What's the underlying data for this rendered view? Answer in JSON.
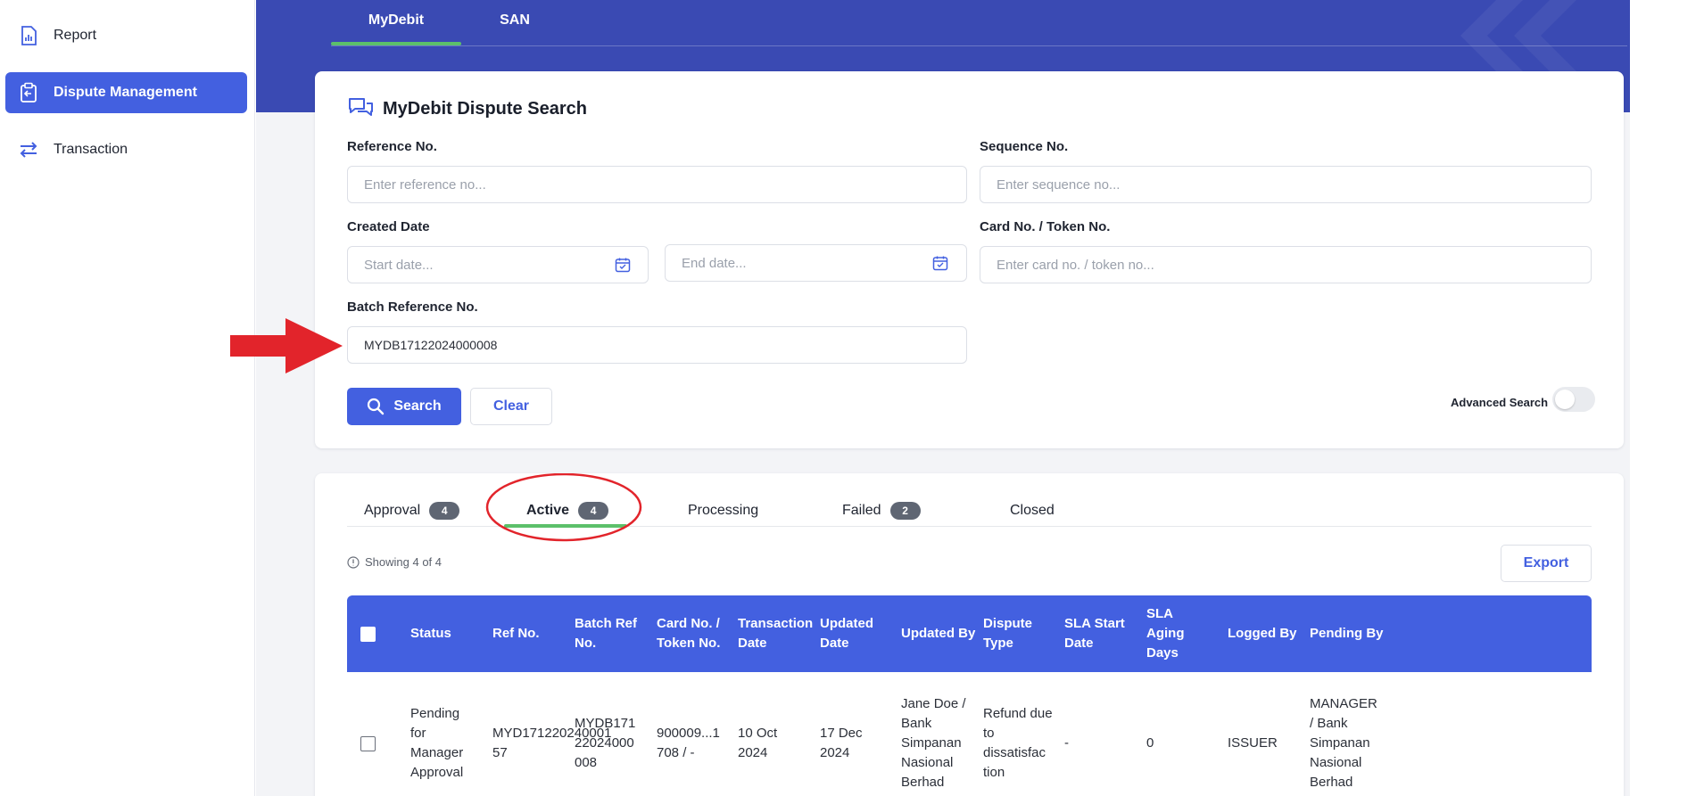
{
  "sidebar": {
    "items": [
      {
        "label": "Report",
        "icon": "report-icon",
        "active": false
      },
      {
        "label": "Dispute Management",
        "icon": "clipboard-icon",
        "active": true
      },
      {
        "label": "Transaction",
        "icon": "swap-arrows-icon",
        "active": false
      }
    ]
  },
  "top_tabs": [
    {
      "label": "MyDebit",
      "active": true
    },
    {
      "label": "SAN",
      "active": false
    }
  ],
  "search_card": {
    "title": "MyDebit Dispute Search",
    "reference_no": {
      "label": "Reference No.",
      "placeholder": "Enter reference no...",
      "value": ""
    },
    "sequence_no": {
      "label": "Sequence No.",
      "placeholder": "Enter sequence no...",
      "value": ""
    },
    "created_date": {
      "label": "Created Date",
      "start_placeholder": "Start date...",
      "end_placeholder": "End date..."
    },
    "card_no": {
      "label": "Card No. / Token No.",
      "placeholder": "Enter card no. / token no..."
    },
    "batch_ref": {
      "label": "Batch Reference No.",
      "value": "MYDB17122024000008"
    },
    "search_label": "Search",
    "clear_label": "Clear",
    "advanced_search_label": "Advanced Search",
    "advanced_search_on": false
  },
  "results": {
    "tabs": [
      {
        "label": "Approval",
        "count": "4"
      },
      {
        "label": "Active",
        "count": "4"
      },
      {
        "label": "Processing",
        "count": ""
      },
      {
        "label": "Failed",
        "count": "2"
      },
      {
        "label": "Closed",
        "count": ""
      }
    ],
    "active_tab": "Active",
    "showing": "Showing 4 of 4",
    "export_label": "Export",
    "columns": [
      "Status",
      "Ref No.",
      "Batch Ref No.",
      "Card No. / Token No.",
      "Transaction Date",
      "Updated Date",
      "Updated By",
      "Dispute Type",
      "SLA Start Date",
      "SLA Aging Days",
      "Logged By",
      "Pending By"
    ],
    "rows": [
      {
        "status": "Pending for Manager Approval",
        "ref_no": "MYD171220240001 57",
        "batch_ref_no": "MYDB171 22024000 008",
        "card_no": "900009...1 708 / -",
        "transaction_date": "10 Oct 2024",
        "updated_date": "17 Dec 2024",
        "updated_by": "Jane Doe / Bank Simpanan Nasional Berhad",
        "dispute_type": "Refund due to dissatisfac tion",
        "sla_start_date": "-",
        "sla_aging_days": "0",
        "logged_by": "ISSUER",
        "pending_by": "MANAGER / Bank Simpanan Nasional Berhad"
      }
    ]
  },
  "colors": {
    "primary": "#4360e0",
    "banner": "#3a4ab3",
    "tab_underline": "#5cc06a",
    "annotation_red": "#e2242b"
  }
}
